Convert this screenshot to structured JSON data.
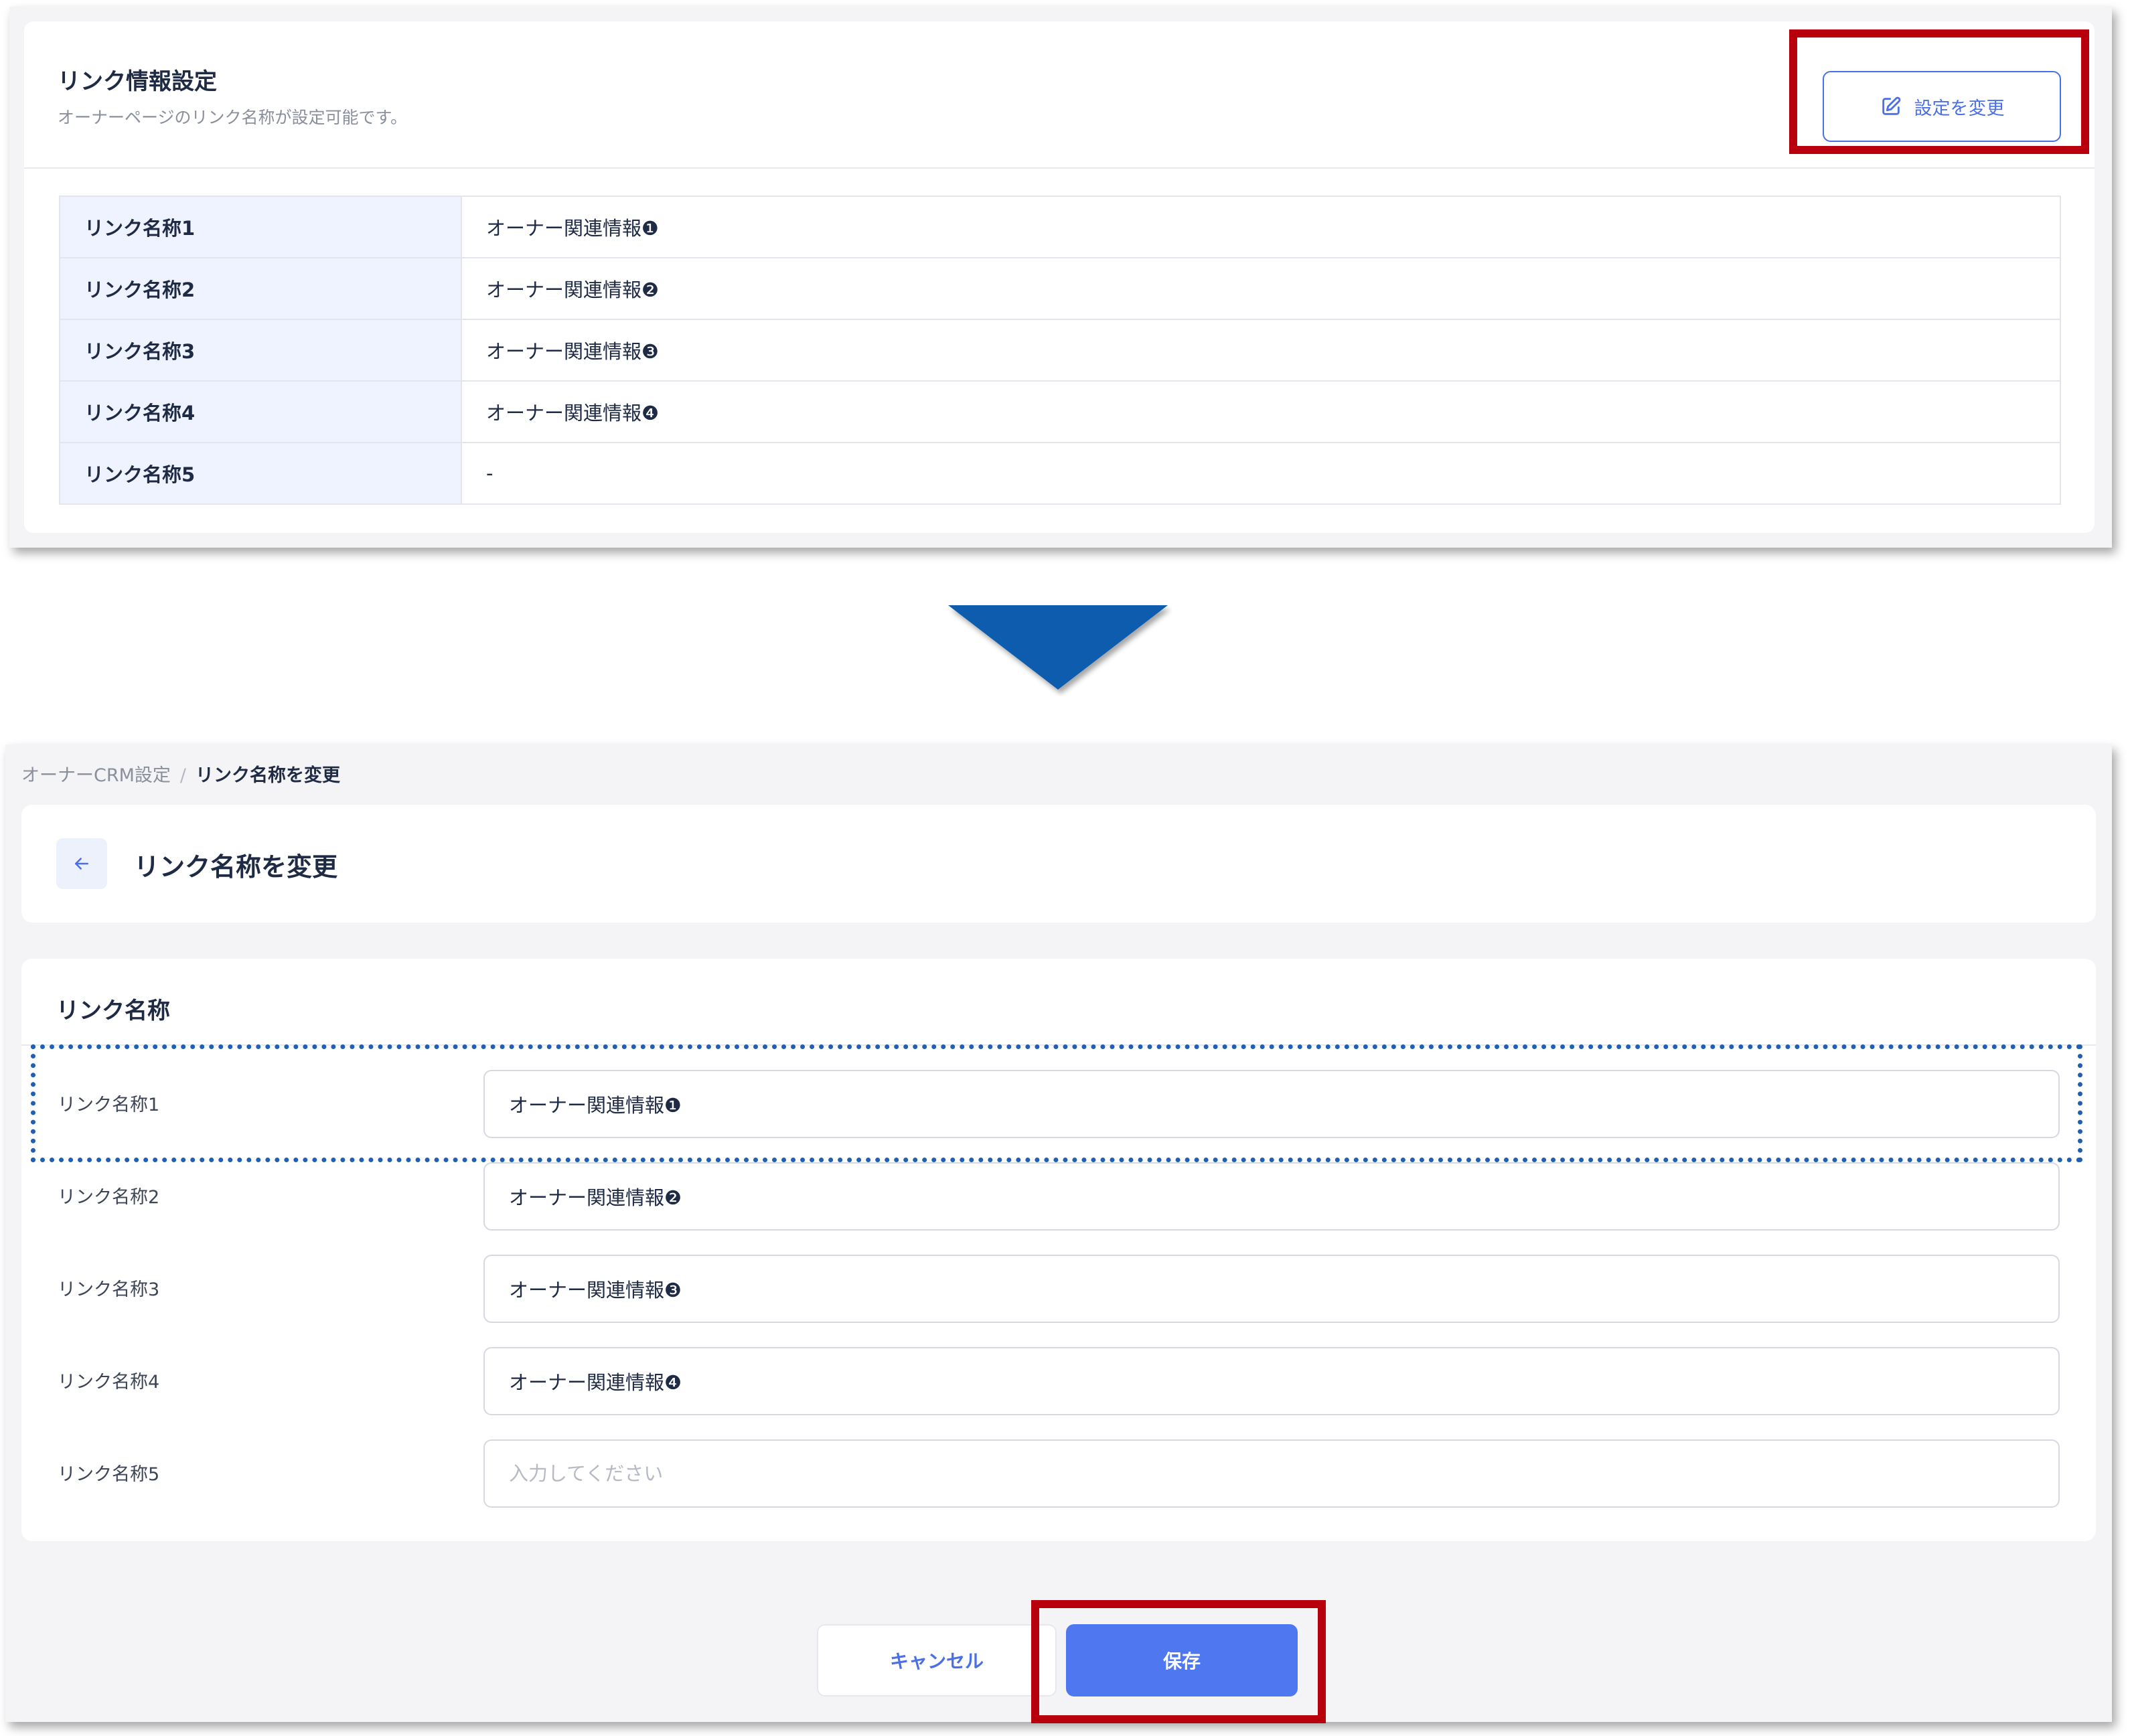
{
  "top_screen": {
    "title": "リンク情報設定",
    "subtitle": "オーナーページのリンク名称が設定可能です。",
    "edit_button_label": "設定を変更",
    "rows": [
      {
        "label": "リンク名称1",
        "value": "オーナー関連情報❶"
      },
      {
        "label": "リンク名称2",
        "value": "オーナー関連情報❷"
      },
      {
        "label": "リンク名称3",
        "value": "オーナー関連情報❸"
      },
      {
        "label": "リンク名称4",
        "value": "オーナー関連情報❹"
      },
      {
        "label": "リンク名称5",
        "value": "-"
      }
    ]
  },
  "bottom_screen": {
    "breadcrumb": {
      "parent": "オーナーCRM設定",
      "separator": "/",
      "current": "リンク名称を変更"
    },
    "page_title": "リンク名称を変更",
    "back_icon": "arrow-left-icon",
    "section_title": "リンク名称",
    "fields": [
      {
        "label": "リンク名称1",
        "value": "オーナー関連情報❶",
        "placeholder": ""
      },
      {
        "label": "リンク名称2",
        "value": "オーナー関連情報❷",
        "placeholder": ""
      },
      {
        "label": "リンク名称3",
        "value": "オーナー関連情報❸",
        "placeholder": ""
      },
      {
        "label": "リンク名称4",
        "value": "オーナー関連情報❹",
        "placeholder": ""
      },
      {
        "label": "リンク名称5",
        "value": "",
        "placeholder": "入力してください"
      }
    ],
    "cancel_label": "キャンセル",
    "save_label": "保存"
  },
  "colors": {
    "accent": "#4a6fe8",
    "save_button": "#4f78f0",
    "highlight_red": "#b8000c",
    "highlight_dotted": "#1f5fb4",
    "arrow": "#0b5cad",
    "label_bg": "#eff3ff"
  },
  "icons": {
    "edit": "edit-icon",
    "back": "arrow-left-icon",
    "transition_arrow": "down-arrow-icon"
  }
}
